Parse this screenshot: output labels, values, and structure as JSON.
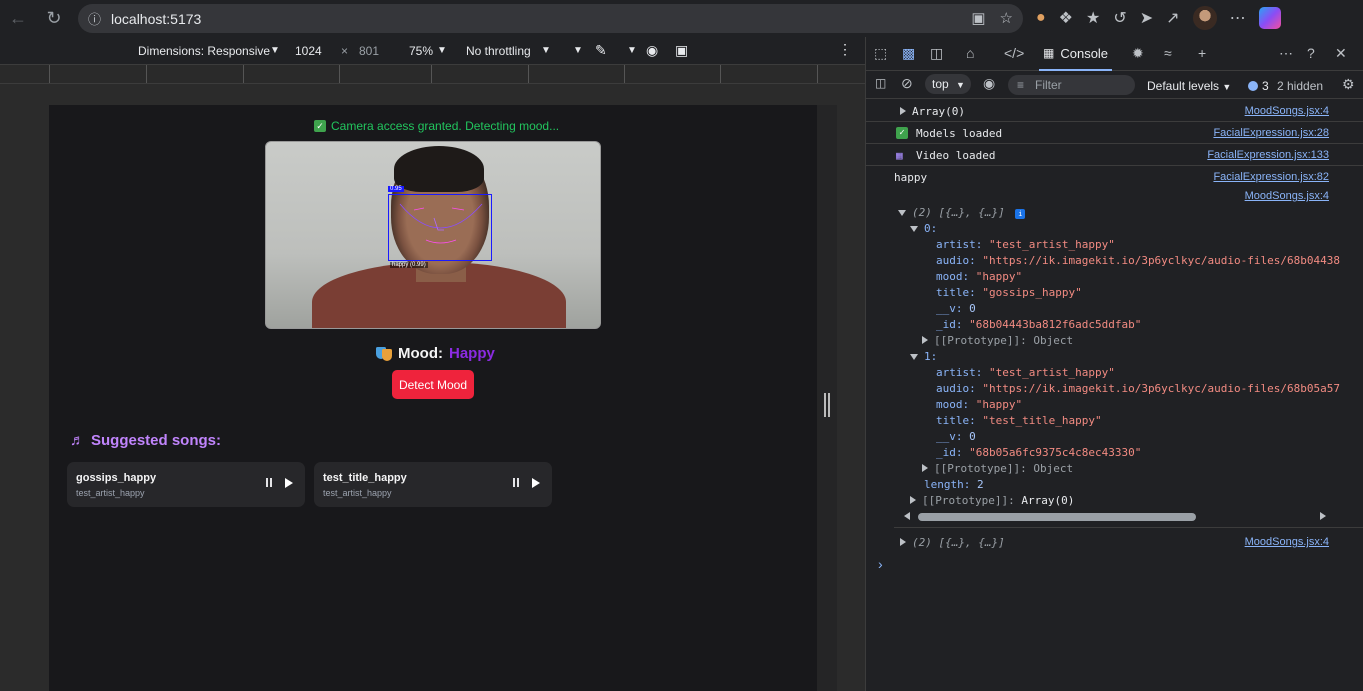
{
  "browser": {
    "url": "localhost:5173"
  },
  "device_toolbar": {
    "dimensions_label": "Dimensions: Responsive",
    "width": "1024",
    "times": "×",
    "height": "801",
    "zoom": "75%",
    "throttling": "No throttling"
  },
  "app": {
    "status_text": "Camera access granted. Detecting mood...",
    "face_score": "0.95",
    "face_label": "happy (0.99)",
    "mood_label": "Mood:",
    "mood_value": "Happy",
    "detect_button": "Detect Mood",
    "suggested_title": "Suggested songs:",
    "songs": [
      {
        "title": "gossips_happy",
        "artist": "test_artist_happy"
      },
      {
        "title": "test_title_happy",
        "artist": "test_artist_happy"
      }
    ]
  },
  "devtools": {
    "console_tab": "Console",
    "context": "top",
    "filter_placeholder": "Filter",
    "levels": "Default levels",
    "issue_count": "3",
    "hidden": "2 hidden",
    "logs": [
      {
        "msg": "Array(0)",
        "src": "MoodSongs.jsx:4"
      },
      {
        "msg": "Models loaded",
        "src": "FacialExpression.jsx:28"
      },
      {
        "msg": "Video loaded",
        "src": "FacialExpression.jsx:133"
      },
      {
        "msg": "happy",
        "src": "FacialExpression.jsx:82"
      },
      {
        "msg": "",
        "src": "MoodSongs.jsx:4"
      }
    ],
    "expanded": {
      "header": "(2) [{…}, {…}]",
      "item0_index": "0:",
      "item0": {
        "artist": "\"test_artist_happy\"",
        "audio": "\"https://ik.imagekit.io/3p6yclkyc/audio-files/68b04438",
        "mood": "\"happy\"",
        "title": "\"gossips_happy\"",
        "v": "0",
        "id": "\"68b04443ba812f6adc5ddfab\""
      },
      "item1_index": "1:",
      "item1": {
        "artist": "\"test_artist_happy\"",
        "audio": "\"https://ik.imagekit.io/3p6yclkyc/audio-files/68b05a57",
        "mood": "\"happy\"",
        "title": "\"test_title_happy\"",
        "v": "0",
        "id": "\"68b05a6fc9375c4c8ec43330\""
      },
      "proto_obj": "[[Prototype]]: Object",
      "length_key": "length:",
      "length_val": "2",
      "proto_arr_key": "[[Prototype]]:",
      "proto_arr_val": "Array(0)",
      "key_artist": "artist:",
      "key_audio": "audio:",
      "key_mood": "mood:",
      "key_title": "title:",
      "key_v": "__v:",
      "key_id": "_id:"
    },
    "last_log": {
      "msg": "(2) [{…}, {…}]",
      "src": "MoodSongs.jsx:4"
    }
  }
}
